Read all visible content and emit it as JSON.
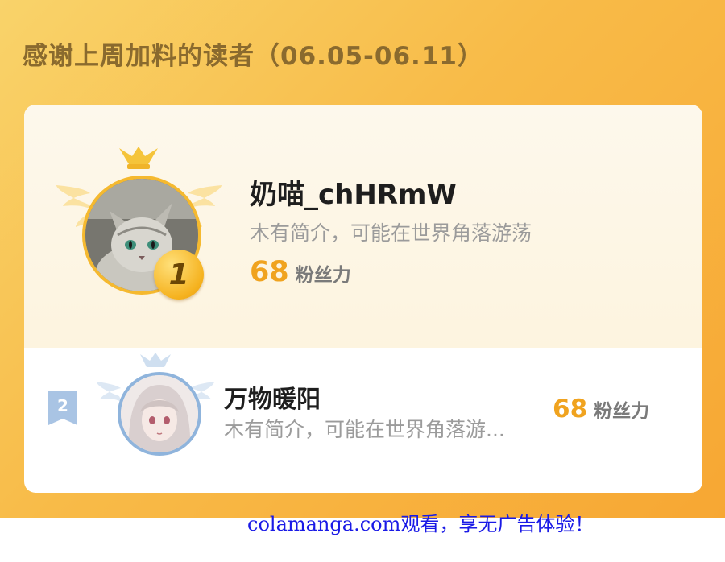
{
  "header": {
    "title": "感谢上周加料的读者（06.05-06.11）"
  },
  "ranking": [
    {
      "rank": "1",
      "name": "奶喵_chHRmW",
      "bio": "木有简介，可能在世界角落游荡",
      "score": "68",
      "score_unit": "粉丝力",
      "avatar": "cat-avatar",
      "badge_color": "#f5b21f"
    },
    {
      "rank": "2",
      "name": "万物暖阳",
      "bio": "木有简介，可能在世界角落游...",
      "score": "68",
      "score_unit": "粉丝力",
      "avatar": "anime-girl-avatar",
      "badge_color": "#8fb4dc"
    }
  ],
  "footer": {
    "text": "colamanga.com观看，享无广告体验！"
  },
  "colors": {
    "panel_bg": "#f8bb48",
    "score": "#f0a31f",
    "watermark": "#1a1ae6"
  }
}
